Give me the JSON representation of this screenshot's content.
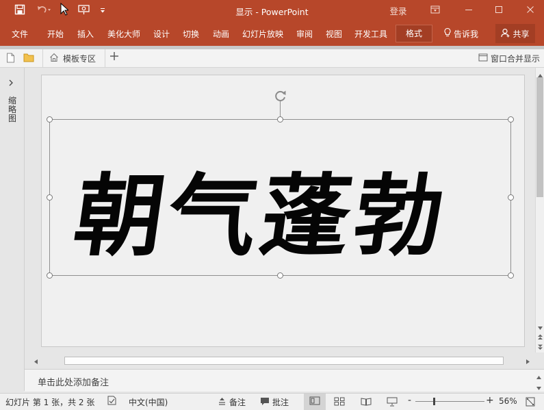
{
  "titlebar": {
    "title_text": "显示 - PowerPoint",
    "login_label": "登录",
    "accent_color": "#b7472a"
  },
  "qat": {
    "icons": [
      "save-icon",
      "undo-icon",
      "start-from-beginning-icon",
      "customize-icon"
    ]
  },
  "ribbon": {
    "tabs": [
      {
        "label": "文件"
      },
      {
        "label": "开始"
      },
      {
        "label": "插入"
      },
      {
        "label": "美化大师"
      },
      {
        "label": "设计"
      },
      {
        "label": "切换"
      },
      {
        "label": "动画"
      },
      {
        "label": "幻灯片放映"
      },
      {
        "label": "审阅"
      },
      {
        "label": "视图"
      },
      {
        "label": "开发工具"
      },
      {
        "label": "格式",
        "active": true
      }
    ],
    "tell_me": "告诉我",
    "share": "共享"
  },
  "doc_tabs": {
    "template_tab": "模板专区",
    "merge_label": "窗口合并显示"
  },
  "left_pane": {
    "vertical_label": "缩略图"
  },
  "slide": {
    "calligraphy_text": "朝气蓬勃"
  },
  "notes": {
    "placeholder": "单击此处添加备注"
  },
  "status": {
    "slide_info": "幻灯片 第 1 张，共 2 张",
    "language": "中文(中国)",
    "notes_label": "备注",
    "comments_label": "批注",
    "zoom_minus": "-",
    "zoom_plus": "+",
    "zoom_percent": "56%",
    "zoom_level": 0.56
  }
}
